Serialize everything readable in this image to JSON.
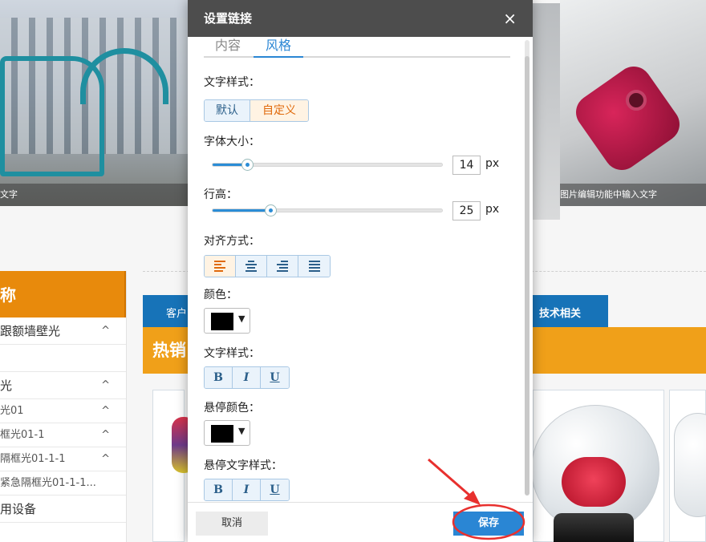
{
  "background": {
    "banner_left_caption": "文字",
    "banner_right_caption": "图片编辑功能中输入文字",
    "sidebar": {
      "title": "称",
      "items": [
        {
          "label": "跟额墙壁光",
          "chevron": "^"
        },
        {
          "label": "",
          "chevron": ""
        },
        {
          "label": "光",
          "chevron": "^"
        },
        {
          "label": "光01",
          "chevron": "^"
        },
        {
          "label": "框光01-1",
          "chevron": "^"
        },
        {
          "label": "隔框光01-1-1",
          "chevron": "^"
        },
        {
          "label": "紧急隔框光01-1-1...",
          "chevron": ""
        },
        {
          "label": "用设备",
          "chevron": ""
        }
      ]
    },
    "nav_left_label": "客户",
    "nav_right_label": "技术相关",
    "hot_title": "热销"
  },
  "modal": {
    "title": "设置链接",
    "close_icon": "×",
    "tabs": [
      {
        "label": "内容",
        "active": false
      },
      {
        "label": "风格",
        "active": true
      }
    ],
    "text_style_label": "文字样式：",
    "text_style_options": [
      "默认",
      "自定义"
    ],
    "text_style_selected": "自定义",
    "font_size_label": "字体大小：",
    "font_size_value": "14",
    "font_size_unit": "px",
    "font_size_fraction": 0.15,
    "line_height_label": "行高：",
    "line_height_value": "25",
    "line_height_unit": "px",
    "line_height_fraction": 0.25,
    "align_label": "对齐方式：",
    "align_options": [
      "align-left",
      "align-center",
      "align-right",
      "align-justify"
    ],
    "align_selected": "align-left",
    "color_label": "颜色：",
    "color_value": "#000000",
    "text_format_label": "文字样式：",
    "format_buttons": [
      "B",
      "I",
      "U"
    ],
    "hover_color_label": "悬停颜色：",
    "hover_color_value": "#000000",
    "hover_format_label": "悬停文字样式：",
    "hover_format_buttons": [
      "B",
      "I",
      "U"
    ],
    "cancel_label": "取消",
    "save_label": "保存"
  },
  "annotation": {
    "highlight_color": "#e8302e"
  },
  "colors": {
    "accent": "#2a86d4",
    "selected_orange": "#e06a0c",
    "header_dark": "#4d4d4d",
    "sidebar_orange": "#e88a0c",
    "nav_blue": "#1773b8"
  }
}
